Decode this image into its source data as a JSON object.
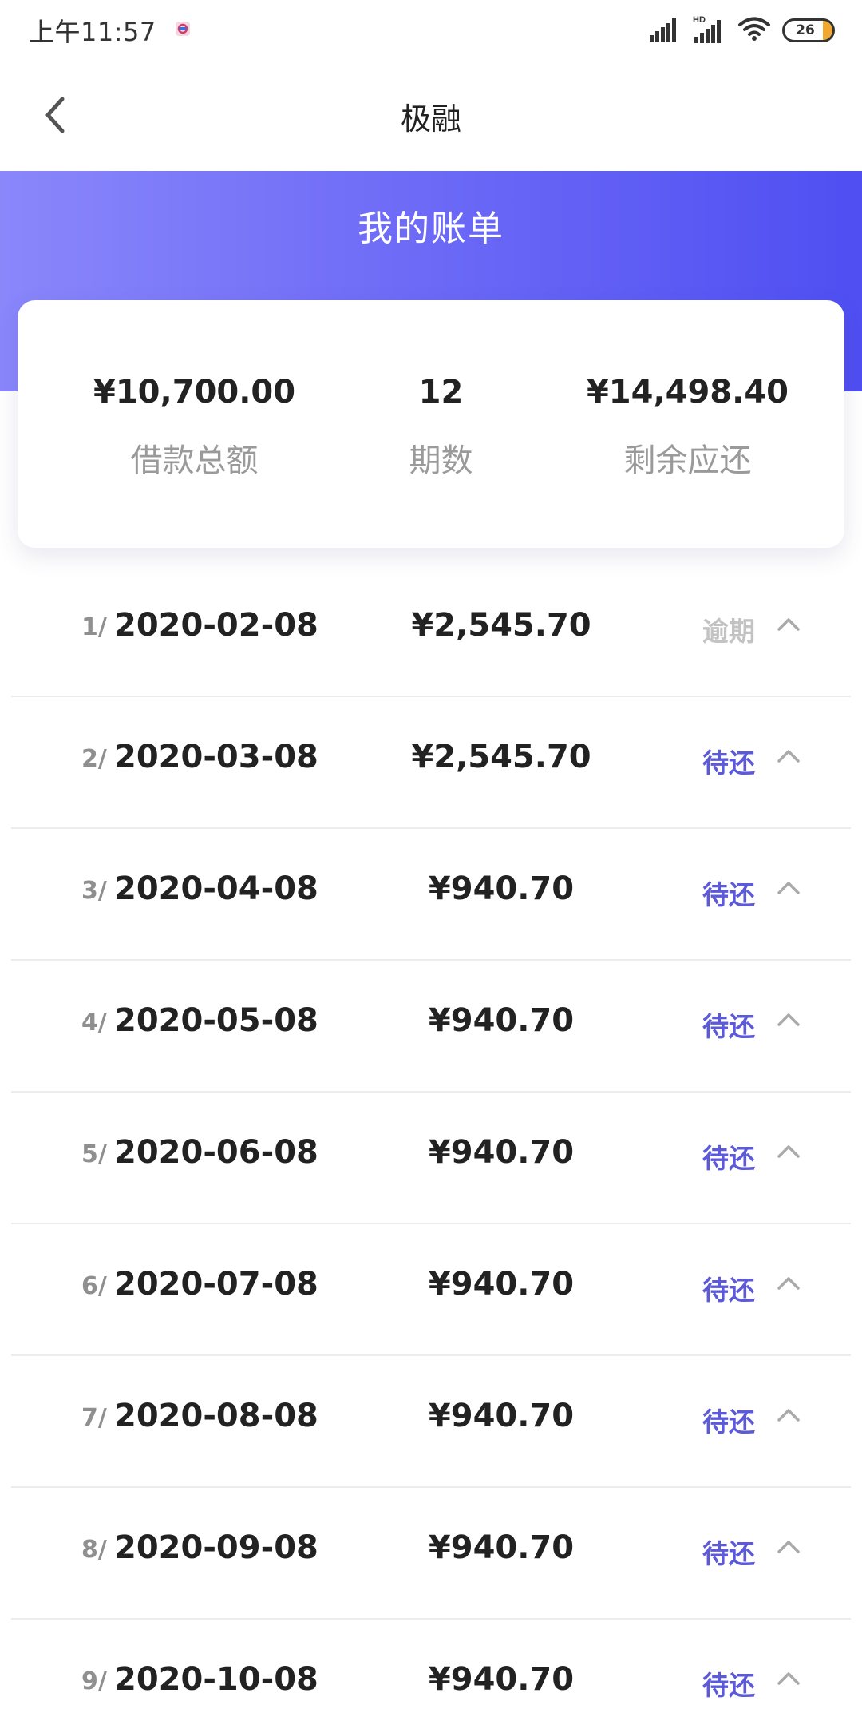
{
  "status_bar": {
    "time": "上午11:57",
    "battery": "26",
    "icons": [
      "notification-app-icon",
      "signal-icon",
      "hd-signal-icon",
      "wifi-icon",
      "battery-icon"
    ]
  },
  "header": {
    "title": "极融",
    "back_icon": "chevron-left-icon"
  },
  "hero": {
    "title": "我的账单",
    "gradient": [
      "#8a87fb",
      "#4f4ff2"
    ]
  },
  "summary": {
    "total_amount": "¥10,700.00",
    "total_amount_label": "借款总额",
    "periods": "12",
    "periods_label": "期数",
    "remaining": "¥14,498.40",
    "remaining_label": "剩余应还"
  },
  "colors": {
    "accent": "#5c5ad9",
    "overdue": "#c3c3c3",
    "divider": "#ececec"
  },
  "installments": [
    {
      "index": "1/",
      "date": "2020-02-08",
      "amount": "¥2,545.70",
      "status": "逾期",
      "state": "overdue"
    },
    {
      "index": "2/",
      "date": "2020-03-08",
      "amount": "¥2,545.70",
      "status": "待还",
      "state": "pending"
    },
    {
      "index": "3/",
      "date": "2020-04-08",
      "amount": "¥940.70",
      "status": "待还",
      "state": "pending"
    },
    {
      "index": "4/",
      "date": "2020-05-08",
      "amount": "¥940.70",
      "status": "待还",
      "state": "pending"
    },
    {
      "index": "5/",
      "date": "2020-06-08",
      "amount": "¥940.70",
      "status": "待还",
      "state": "pending"
    },
    {
      "index": "6/",
      "date": "2020-07-08",
      "amount": "¥940.70",
      "status": "待还",
      "state": "pending"
    },
    {
      "index": "7/",
      "date": "2020-08-08",
      "amount": "¥940.70",
      "status": "待还",
      "state": "pending"
    },
    {
      "index": "8/",
      "date": "2020-09-08",
      "amount": "¥940.70",
      "status": "待还",
      "state": "pending"
    },
    {
      "index": "9/",
      "date": "2020-10-08",
      "amount": "¥940.70",
      "status": "待还",
      "state": "pending"
    }
  ]
}
